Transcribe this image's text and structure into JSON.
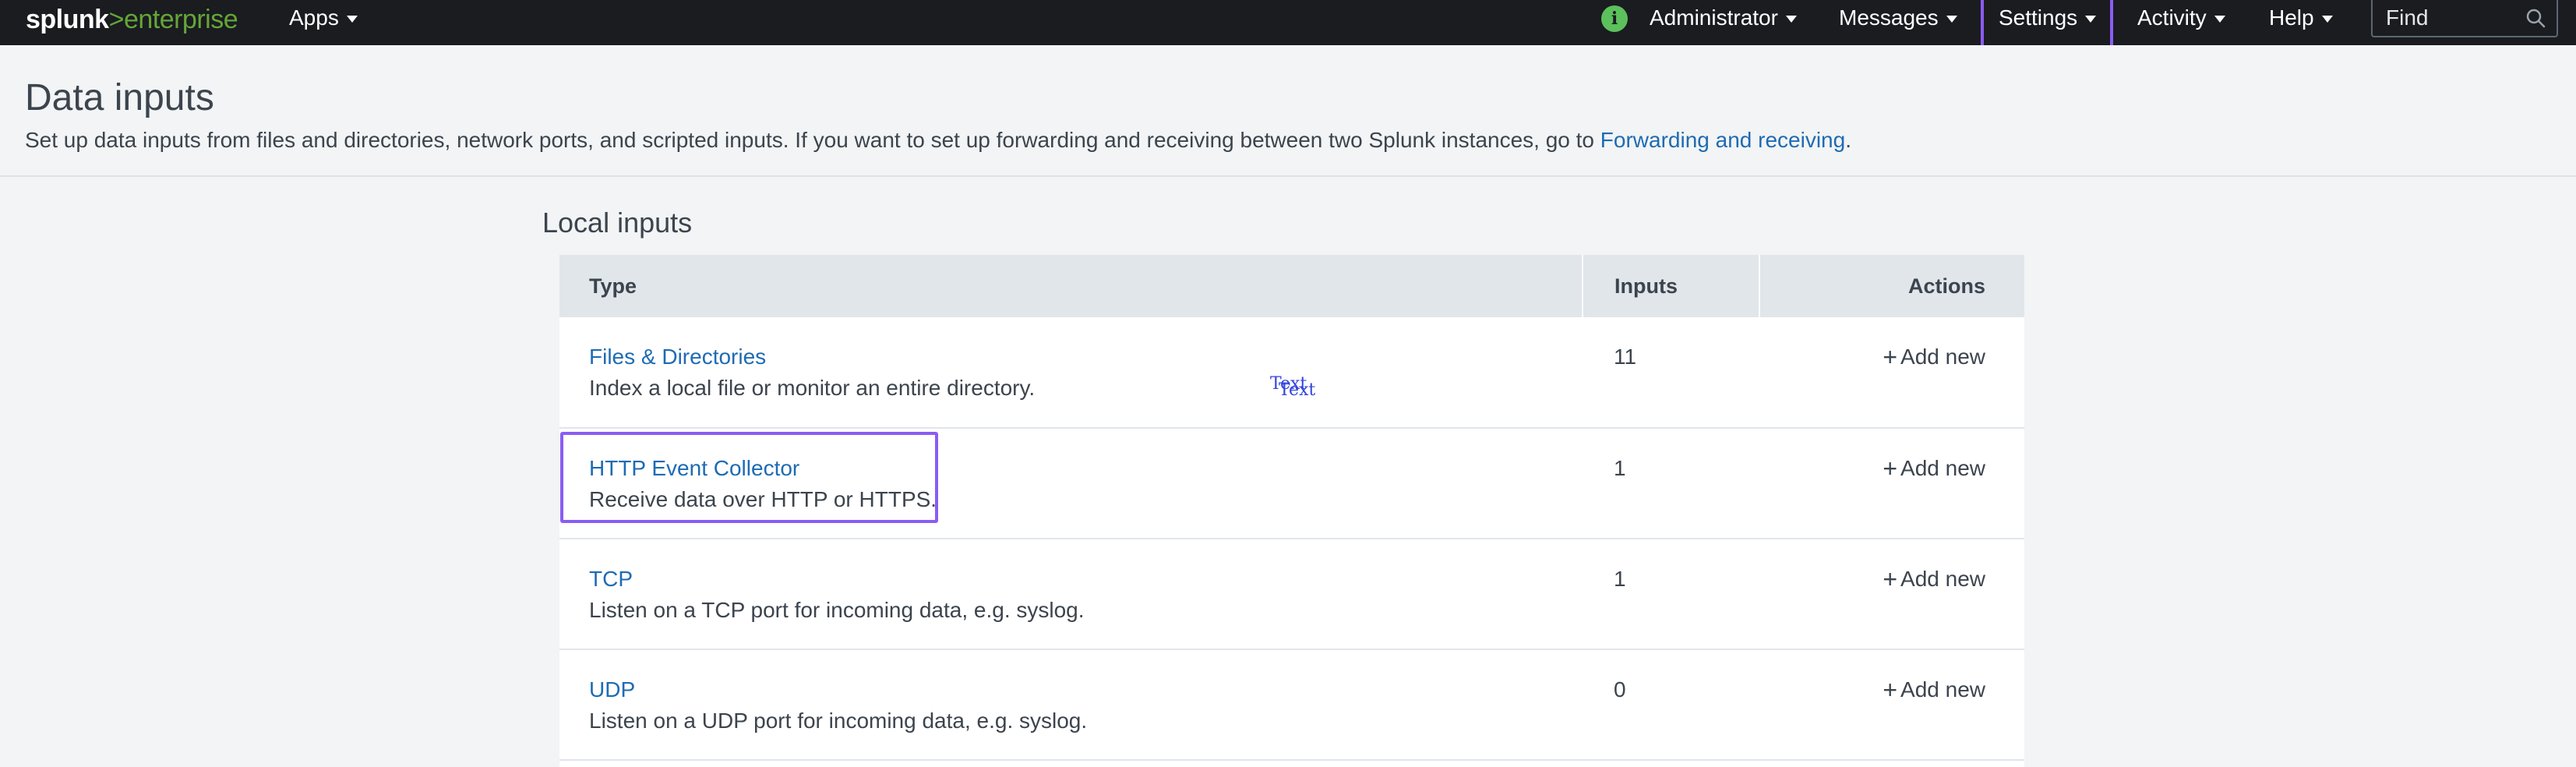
{
  "topbar": {
    "logo_brand": "splunk",
    "logo_sep": ">",
    "logo_product": "enterprise",
    "apps_label": "Apps",
    "administrator_label": "Administrator",
    "messages_label": "Messages",
    "settings_label": "Settings",
    "activity_label": "Activity",
    "help_label": "Help",
    "info_icon_glyph": "i",
    "find_placeholder": "Find",
    "selected_menu": "Settings"
  },
  "header": {
    "title": "Data inputs",
    "description": "Set up data inputs from files and directories, network ports, and scripted inputs. If you want to set up forwarding and receiving between two Splunk instances, go to ",
    "forwarding_link": "Forwarding and receiving",
    "description_end": "."
  },
  "section": {
    "title": "Local inputs"
  },
  "table": {
    "headers": {
      "type": "Type",
      "inputs": "Inputs",
      "actions": "Actions"
    },
    "rows": [
      {
        "name": "Files & Directories",
        "description": "Index a local file or monitor an entire directory.",
        "inputs": "11",
        "action": "Add new"
      },
      {
        "name": "HTTP Event Collector",
        "description": "Receive data over HTTP or HTTPS.",
        "inputs": "1",
        "action": "Add new"
      },
      {
        "name": "TCP",
        "description": "Listen on a TCP port for incoming data, e.g. syslog.",
        "inputs": "1",
        "action": "Add new"
      },
      {
        "name": "UDP",
        "description": "Listen on a UDP port for incoming data, e.g. syslog.",
        "inputs": "0",
        "action": "Add new"
      }
    ],
    "plus_glyph": "+",
    "highlighted_row": "HTTP Event Collector"
  },
  "stray": {
    "text_a": "Text",
    "text_b": "Text"
  },
  "colors": {
    "topbar_bg": "#1a1c20",
    "brand_green": "#65a637",
    "link_blue": "#1e6bb3",
    "highlight_purple": "#8a5cf5",
    "table_header_bg": "#e1e6eb",
    "page_bg": "#f2f4f5"
  }
}
